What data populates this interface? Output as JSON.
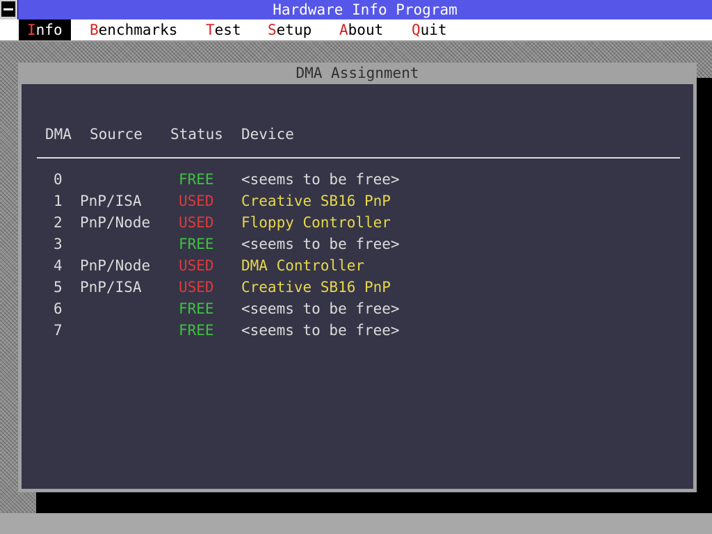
{
  "app": {
    "title": "Hardware Info Program"
  },
  "menu": [
    {
      "hotkey": "I",
      "rest": "nfo",
      "active": true
    },
    {
      "hotkey": "B",
      "rest": "enchmarks",
      "active": false
    },
    {
      "hotkey": "T",
      "rest": "est",
      "active": false
    },
    {
      "hotkey": "S",
      "rest": "etup",
      "active": false
    },
    {
      "hotkey": "A",
      "rest": "bout",
      "active": false
    },
    {
      "hotkey": "Q",
      "rest": "uit",
      "active": false
    }
  ],
  "window": {
    "title": "DMA Assignment",
    "columns": {
      "dma": "DMA",
      "source": "Source",
      "status": "Status",
      "device": "Device"
    },
    "rows": [
      {
        "dma": "0",
        "source": "",
        "status": "FREE",
        "device": "<seems to be free>"
      },
      {
        "dma": "1",
        "source": "PnP/ISA",
        "status": "USED",
        "device": "Creative SB16 PnP"
      },
      {
        "dma": "2",
        "source": "PnP/Node",
        "status": "USED",
        "device": "Floppy Controller"
      },
      {
        "dma": "3",
        "source": "",
        "status": "FREE",
        "device": "<seems to be free>"
      },
      {
        "dma": "4",
        "source": "PnP/Node",
        "status": "USED",
        "device": "DMA Controller"
      },
      {
        "dma": "5",
        "source": "PnP/ISA",
        "status": "USED",
        "device": "Creative SB16 PnP"
      },
      {
        "dma": "6",
        "source": "",
        "status": "FREE",
        "device": "<seems to be free>"
      },
      {
        "dma": "7",
        "source": "",
        "status": "FREE",
        "device": "<seems to be free>"
      }
    ]
  },
  "colors": {
    "title_bar": "#5656e8",
    "client_bg": "#353547",
    "status_free": "#3fc23f",
    "status_used": "#e03a3a",
    "device_used": "#e8d84a",
    "hotkey": "#d42020"
  },
  "icons": {
    "system_menu": "system-menu-icon"
  }
}
